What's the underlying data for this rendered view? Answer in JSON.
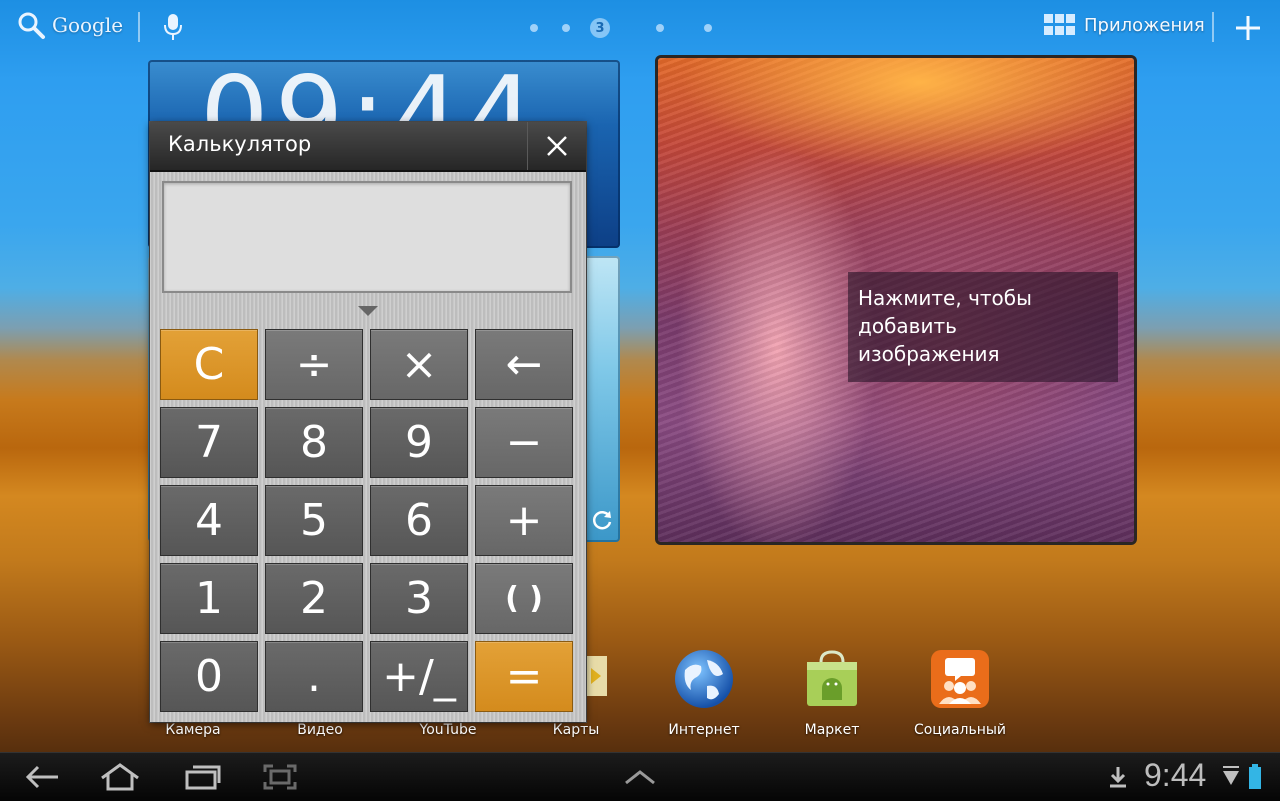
{
  "top_bar": {
    "search_label": "Google",
    "current_page": "3",
    "apps_label": "Приложения"
  },
  "clock_widget": {
    "time": "09:44"
  },
  "photo_widget": {
    "caption": "Нажмите, чтобы\nдобавить\nизображения"
  },
  "calculator": {
    "title": "Калькулятор",
    "display_value": "",
    "keys": [
      {
        "label": "C",
        "name": "clear"
      },
      {
        "label": "÷",
        "name": "divide"
      },
      {
        "label": "×",
        "name": "multiply"
      },
      {
        "label": "←",
        "name": "backspace"
      },
      {
        "label": "7",
        "name": "7"
      },
      {
        "label": "8",
        "name": "8"
      },
      {
        "label": "9",
        "name": "9"
      },
      {
        "label": "−",
        "name": "minus"
      },
      {
        "label": "4",
        "name": "4"
      },
      {
        "label": "5",
        "name": "5"
      },
      {
        "label": "6",
        "name": "6"
      },
      {
        "label": "+",
        "name": "plus"
      },
      {
        "label": "1",
        "name": "1"
      },
      {
        "label": "2",
        "name": "2"
      },
      {
        "label": "3",
        "name": "3"
      },
      {
        "label": "( )",
        "name": "parentheses"
      },
      {
        "label": "0",
        "name": "0"
      },
      {
        "label": ".",
        "name": "decimal"
      },
      {
        "label": "+/_",
        "name": "plus-minus"
      },
      {
        "label": "=",
        "name": "equals"
      }
    ]
  },
  "dock": [
    {
      "label": "Камера",
      "icon": "camera-icon"
    },
    {
      "label": "Видео",
      "icon": "video-icon"
    },
    {
      "label": "YouTube",
      "icon": "youtube-icon"
    },
    {
      "label": "Карты",
      "icon": "maps-icon"
    },
    {
      "label": "Интернет",
      "icon": "globe-icon"
    },
    {
      "label": "Маркет",
      "icon": "market-icon"
    },
    {
      "label": "Социальный",
      "icon": "social-icon"
    }
  ],
  "status_bar": {
    "time": "9:44"
  },
  "colors": {
    "accent_orange": "#d48b1d",
    "key_gray": "#5f5f5f",
    "title_bar": "#2b2b2b"
  }
}
